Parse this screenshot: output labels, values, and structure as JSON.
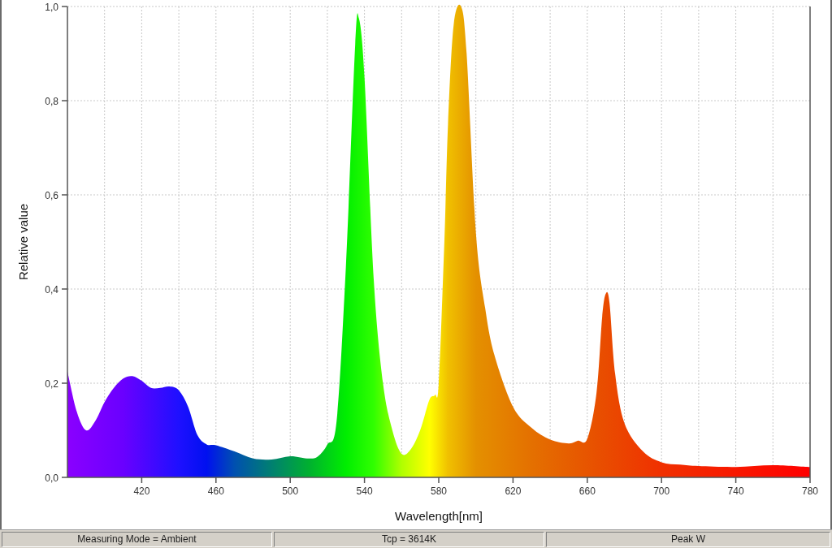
{
  "chart": {
    "chart_data": {
      "type": "area",
      "xlabel": "Wavelength[nm]",
      "ylabel": "Relative value",
      "x": [
        380,
        385,
        390,
        395,
        400,
        405,
        410,
        415,
        420,
        425,
        430,
        435,
        440,
        445,
        450,
        455,
        460,
        470,
        480,
        490,
        500,
        510,
        515,
        520,
        525,
        530,
        535,
        537,
        540,
        545,
        550,
        555,
        560,
        565,
        570,
        575,
        578,
        580,
        583,
        585,
        588,
        592,
        595,
        600,
        605,
        610,
        620,
        630,
        640,
        650,
        655,
        660,
        665,
        668,
        670,
        672,
        675,
        680,
        690,
        700,
        710,
        720,
        740,
        760,
        780
      ],
      "values": [
        0.225,
        0.14,
        0.1,
        0.12,
        0.16,
        0.19,
        0.21,
        0.215,
        0.205,
        0.19,
        0.19,
        0.193,
        0.185,
        0.15,
        0.09,
        0.07,
        0.068,
        0.055,
        0.04,
        0.038,
        0.045,
        0.04,
        0.045,
        0.07,
        0.12,
        0.45,
        0.92,
        0.975,
        0.85,
        0.42,
        0.2,
        0.1,
        0.05,
        0.06,
        0.1,
        0.165,
        0.175,
        0.2,
        0.5,
        0.75,
        0.96,
        1.0,
        0.9,
        0.52,
        0.36,
        0.26,
        0.15,
        0.105,
        0.08,
        0.072,
        0.078,
        0.082,
        0.18,
        0.34,
        0.39,
        0.37,
        0.22,
        0.115,
        0.055,
        0.032,
        0.027,
        0.024,
        0.022,
        0.026,
        0.022
      ],
      "xlim": [
        380,
        780
      ],
      "ylim": [
        0,
        1
      ],
      "xticks": [
        420,
        460,
        500,
        540,
        580,
        620,
        660,
        700,
        740,
        780
      ],
      "yticks": [
        {
          "value": 0,
          "label": "0,0"
        },
        {
          "value": 0.2,
          "label": "0,2"
        },
        {
          "value": 0.4,
          "label": "0,4"
        },
        {
          "value": 0.6,
          "label": "0,6"
        },
        {
          "value": 0.8,
          "label": "0,8"
        },
        {
          "value": 1,
          "label": "1,0"
        }
      ],
      "grid": true
    }
  },
  "status_bar": {
    "panels": [
      "Measuring Mode = Ambient",
      "Tcp = 3614K",
      "Peak W"
    ]
  }
}
